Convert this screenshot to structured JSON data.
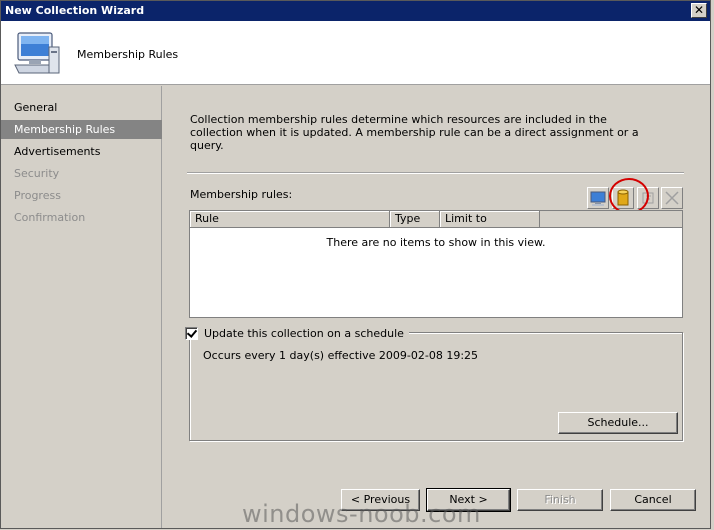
{
  "window": {
    "title": "New Collection Wizard",
    "close_glyph": "✕"
  },
  "header": {
    "title": "Membership Rules",
    "icon": "computer-icon"
  },
  "nav": {
    "items": [
      {
        "label": "General",
        "state": "normal"
      },
      {
        "label": "Membership Rules",
        "state": "selected"
      },
      {
        "label": "Advertisements",
        "state": "normal"
      },
      {
        "label": "Security",
        "state": "disabled"
      },
      {
        "label": "Progress",
        "state": "disabled"
      },
      {
        "label": "Confirmation",
        "state": "disabled"
      }
    ]
  },
  "main": {
    "description": "Collection membership rules determine which resources are included in the collection when it is updated. A membership rule can be a direct assignment or a query.",
    "rules_label": "Membership rules:",
    "toolbar": {
      "buttons": [
        "computer-icon",
        "database-query-icon",
        "properties-icon",
        "delete-icon"
      ],
      "highlighted": "database-query-icon",
      "highlight_color": "#d40000"
    },
    "table": {
      "columns": [
        "Rule",
        "Type",
        "Limit to"
      ],
      "empty_text": "There are no items to show in this view."
    },
    "schedule": {
      "checkbox_label": "Update this collection on a schedule",
      "checked": true,
      "occurs_text": "Occurs every 1 day(s) effective 2009-02-08 19:25",
      "schedule_button": "Schedule..."
    }
  },
  "footer": {
    "previous": "< Previous",
    "next": "Next >",
    "finish": "Finish",
    "cancel": "Cancel"
  },
  "watermark": "windows-noob.com",
  "colors": {
    "titlebar": "#0b246a",
    "nav_selected": "#848484",
    "dialog_face": "#d4d0c8"
  }
}
